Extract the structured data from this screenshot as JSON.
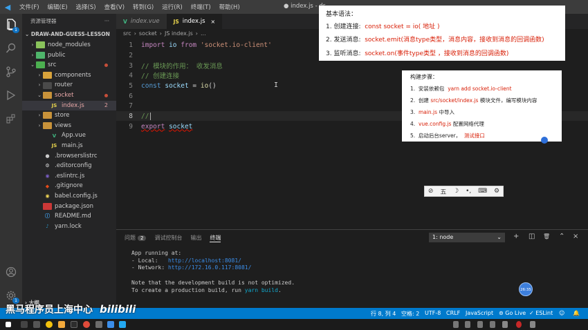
{
  "titlebar": {
    "menu": [
      "文件(F)",
      "编辑(E)",
      "选择(S)",
      "查看(V)",
      "转到(G)",
      "运行(R)",
      "终端(T)",
      "帮助(H)"
    ],
    "window_title": "● index.js - dr"
  },
  "activitybar": {
    "explorer_badge": "1",
    "settings_badge": "1"
  },
  "sidebar": {
    "title": "资源管理器",
    "more": "···",
    "project": "DRAW-AND-GUESS-LESSON",
    "items": [
      {
        "label": "node_modules",
        "chev": "›"
      },
      {
        "label": "public",
        "chev": "›"
      },
      {
        "label": "src",
        "chev": "⌄"
      },
      {
        "label": "components",
        "chev": "›"
      },
      {
        "label": "router",
        "chev": "›"
      },
      {
        "label": "socket",
        "chev": "⌄"
      },
      {
        "label": "index.js",
        "chev": "",
        "num": "2"
      },
      {
        "label": "store",
        "chev": "›"
      },
      {
        "label": "views",
        "chev": "›"
      },
      {
        "label": "App.vue",
        "chev": ""
      },
      {
        "label": "main.js",
        "chev": ""
      },
      {
        "label": ".browserslistrc",
        "chev": ""
      },
      {
        "label": ".editorconfig",
        "chev": ""
      },
      {
        "label": ".eslintrc.js",
        "chev": ""
      },
      {
        "label": ".gitignore",
        "chev": ""
      },
      {
        "label": "babel.config.js",
        "chev": ""
      },
      {
        "label": "package.json",
        "chev": ""
      },
      {
        "label": "README.md",
        "chev": ""
      },
      {
        "label": "yarn.lock",
        "chev": ""
      }
    ],
    "outline": "大纲"
  },
  "tabs": [
    {
      "label": "index.vue",
      "icon": "V"
    },
    {
      "label": "index.js",
      "icon": "JS",
      "close": "×"
    }
  ],
  "breadcrumb": [
    "src",
    "›",
    "socket",
    "›",
    "JS index.js",
    "›",
    "..."
  ],
  "code": {
    "l1": {
      "n": "1",
      "kw": "import",
      "var": "io",
      "from": "from",
      "str": "'socket.io-client'"
    },
    "l2": {
      "n": "2"
    },
    "l3": {
      "n": "3",
      "cm": "// 模块的作用： 收发消息"
    },
    "l4": {
      "n": "4",
      "cm": "// 创建连接"
    },
    "l5": {
      "n": "5",
      "kw": "const",
      "var": "socket",
      "eq": " = ",
      "fn": "io",
      "paren": "()"
    },
    "l6": {
      "n": "6"
    },
    "l7": {
      "n": "7"
    },
    "l8": {
      "n": "8",
      "cm": "//"
    },
    "l9": {
      "n": "9",
      "kw": "export",
      "var": "socket"
    }
  },
  "panel": {
    "tabs": [
      "问题",
      "调试控制台",
      "输出",
      "终端"
    ],
    "problems_badge": "2",
    "terminal_select": "1: node",
    "caret": "⌄",
    "buttons": [
      "+",
      "◫",
      "🗑",
      "⌃",
      "×"
    ],
    "terminal": {
      "t1": "App running at:",
      "t2_pre": "- Local:   ",
      "t2_link": "http://localhost:8081/",
      "t3_pre": "- Network: ",
      "t3_link": "http://172.16.0.117:8081/",
      "t4": "Note that the development build is not optimized.",
      "t5_pre": "To create a production build, run ",
      "t5_cmd": "yarn build",
      "t5_post": "."
    }
  },
  "statusbar": {
    "position": "行 8, 列 4",
    "spaces": "空格: 2",
    "encoding": "UTF-8",
    "eol": "CRLF",
    "language": "JavaScript",
    "golive": "⊚ Go Live",
    "eslint": "✓ ESLint"
  },
  "watermark": {
    "text": "黑马程序员上海中心",
    "bili": "bilibili"
  },
  "card_basic": {
    "title": "基本语法：",
    "r1_pre": "1. 创建连接:  ",
    "r1_red": "const socket = io( 地址 )",
    "r2_pre": "2. 发送消息:  ",
    "r2_red": "socket.emit(消息type类型，消息内容，接收到消息的回调函数)",
    "r3_pre": "3. 监听消息:  ",
    "r3_red": "socket.on(事件type类型 ，接收到消息的回调函数)"
  },
  "card_steps": {
    "title": "构建步骤：",
    "s1_pre": "1.  安装依赖包  ",
    "s1_red": "yarn add socket.io-client",
    "s2_pre": "2.  创建 ",
    "s2_red": "src/socket/index.js",
    "s2_post": " 模块文件，编写模块内容",
    "s3_pre": "3.  ",
    "s3_red": "main.js",
    "s3_post": " 中导入",
    "s4_pre": "4.  ",
    "s4_red": "vue.config.js",
    "s4_post": " 配置网络代理",
    "s5_pre": "5.  启动后台server，  ",
    "s5_red": "测试接口"
  },
  "floatbar": [
    "⊘",
    "五",
    "☽",
    "•,",
    "⌨",
    "⚙"
  ],
  "clock_bubble": "26:35",
  "colors": {
    "accent": "#007acc",
    "red": "#d81e06"
  }
}
